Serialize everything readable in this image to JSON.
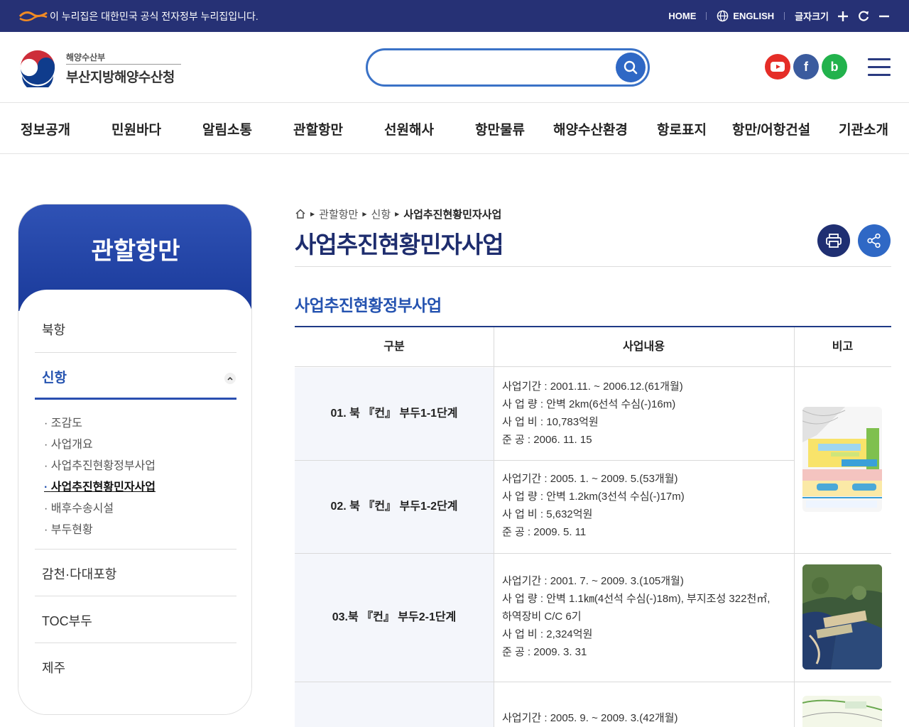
{
  "topbar": {
    "gov_notice": "이 누리집은 대한민국 공식 전자정부 누리집입니다.",
    "home": "HOME",
    "english": "ENGLISH",
    "font_size": "글자크기"
  },
  "header": {
    "logo_sub": "해양수산부",
    "logo_main": "부산지방해양수산청",
    "search_placeholder": ""
  },
  "social": {
    "youtube": "▶",
    "facebook": "f",
    "blog": "b"
  },
  "gnb": [
    "정보공개",
    "민원바다",
    "알림소통",
    "관할항만",
    "선원해사",
    "항만물류",
    "해양수산환경",
    "항로표지",
    "항만/어항건설",
    "기관소개"
  ],
  "lnb": {
    "title": "관할항만",
    "items": [
      "북항",
      "신항",
      "감천·다대포항",
      "TOC부두",
      "제주"
    ],
    "sub_items": [
      "조감도",
      "사업개요",
      "사업추진현황정부사업",
      "사업추진현황민자사업",
      "배후수송시설",
      "부두현황"
    ]
  },
  "breadcrumb": [
    "관할항만",
    "신항",
    "사업추진현황민자사업"
  ],
  "page_title": "사업추진현황민자사업",
  "section_title": "사업추진현황정부사업",
  "table": {
    "headers": [
      "구분",
      "사업내용",
      "비고"
    ],
    "rows": [
      {
        "label": "01. 북 『컨』 부두1-1단계",
        "lines": [
          "사업기간 : 2001.11. ~ 2006.12.(61개월)",
          "사 업 량 : 안벽 2km(6선석 수심(-)16m)",
          "사 업 비 : 10,783억원",
          "준 공 : 2006. 11. 15"
        ]
      },
      {
        "label": "02. 북 『컨』 부두1-2단계",
        "lines": [
          "사업기간 : 2005. 1. ~ 2009. 5.(53개월)",
          "사 업 량 : 안벽 1.2km(3선석 수심(-)17m)",
          "사 업 비 : 5,632억원",
          "준 공 : 2009. 5. 11"
        ]
      },
      {
        "label": "03.북 『컨』 부두2-1단계",
        "lines": [
          "사업기간 : 2001. 7. ~ 2009. 3.(105개월)",
          "사 업 량 : 안벽 1.1㎞(4선석 수심(-)18m), 부지조성 322천㎡,",
          "하역장비 C/C 6기",
          "사 업 비 : 2,324억원",
          "준 공 : 2009. 3. 31"
        ]
      },
      {
        "label": "",
        "lines": [
          "사업기간 : 2005. 9. ~ 2009. 3.(42개월)"
        ]
      }
    ]
  }
}
